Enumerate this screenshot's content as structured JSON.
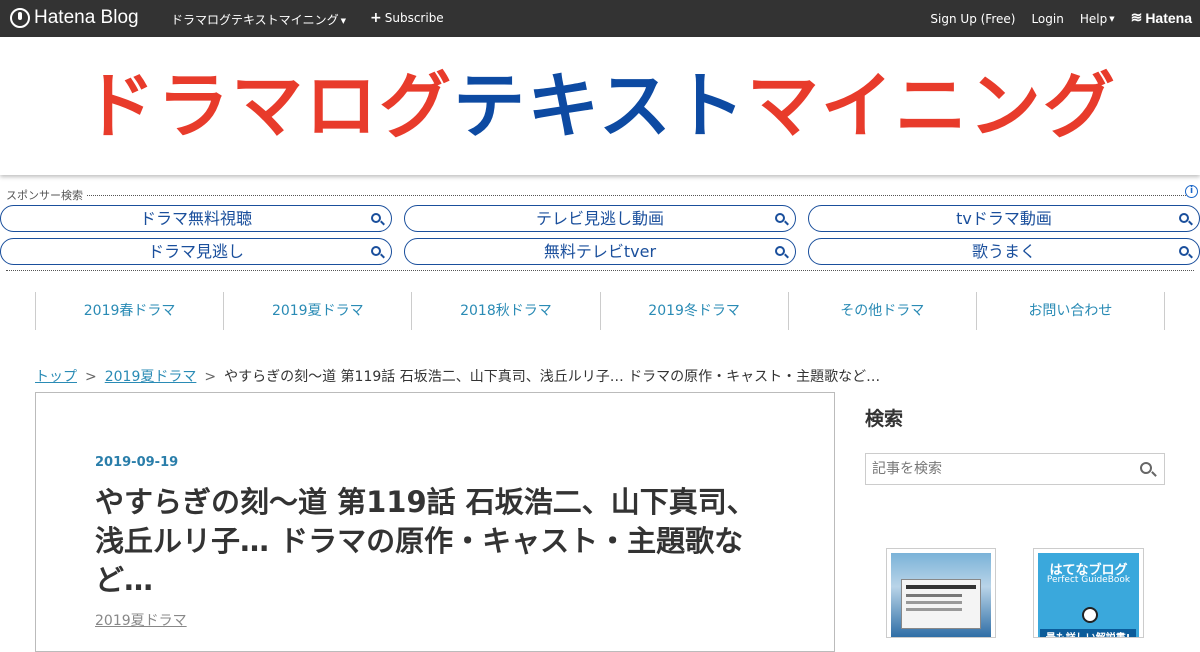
{
  "topbar": {
    "brand": "Hatena Blog",
    "blog_menu": "ドラマログテキストマイニング",
    "subscribe": "Subscribe",
    "signup": "Sign Up (Free)",
    "login": "Login",
    "help": "Help",
    "hatena": "Hatena"
  },
  "header": {
    "title_part1": "ドラマログ",
    "title_part2": "テキスト",
    "title_part3": "マイニング",
    "colors": {
      "red": "#e83b2b",
      "blue": "#0d4aa2"
    }
  },
  "sponsor": {
    "label": "スポンサー検索",
    "info": "i",
    "buttons": [
      "ドラマ無料視聴",
      "テレビ見逃し動画",
      "tvドラマ動画",
      "ドラマ見逃し",
      "無料テレビtver",
      "歌うまく"
    ]
  },
  "nav": {
    "items": [
      "2019春ドラマ",
      "2019夏ドラマ",
      "2018秋ドラマ",
      "2019冬ドラマ",
      "その他ドラマ",
      "お問い合わせ"
    ]
  },
  "breadcrumb": {
    "top": "トップ",
    "sep": ">",
    "category": "2019夏ドラマ",
    "current": "やすらぎの刻～道 第119話 石坂浩二、山下真司、浅丘ルリ子… ドラマの原作・キャスト・主題歌など…"
  },
  "entry": {
    "date": "2019-09-19",
    "title": "やすらぎの刻～道 第119話 石坂浩二、山下真司、浅丘ルリ子… ドラマの原作・キャスト・主題歌など…",
    "category": "2019夏ドラマ"
  },
  "sidebar": {
    "search_title": "検索",
    "search_placeholder": "記事を検索",
    "book2_title": "はてなブログ",
    "book2_subtitle": "Perfect GuideBook",
    "book2_tagline": "最も詳しい解説書!"
  }
}
